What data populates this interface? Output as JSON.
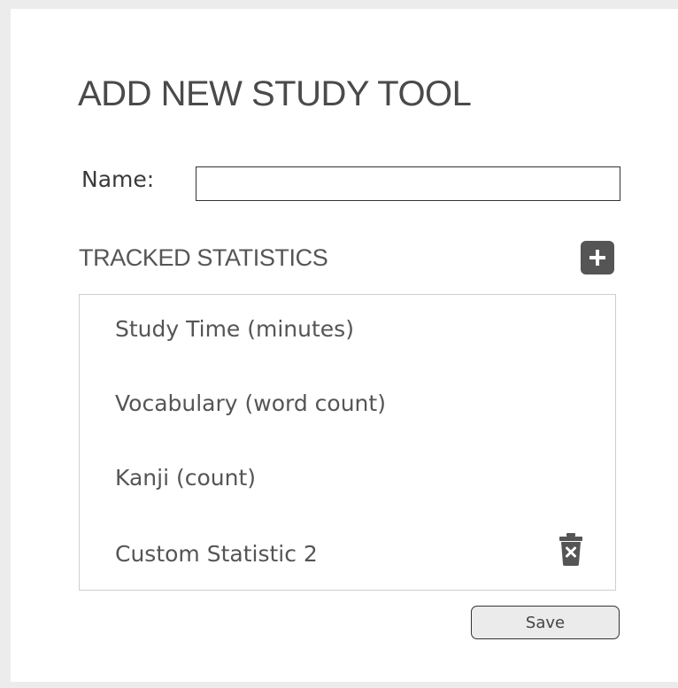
{
  "dialog": {
    "title": "ADD NEW STUDY TOOL",
    "name_label": "Name:",
    "name_value": "",
    "section_title": "TRACKED STATISTICS",
    "add_icon": "plus-icon",
    "delete_icon": "trash-icon",
    "statistics": [
      {
        "label": "Study Time (minutes)"
      },
      {
        "label": "Vocabulary (word count)"
      },
      {
        "label": "Kanji (count)"
      },
      {
        "label": "Custom Statistic 2"
      }
    ],
    "save_label": "Save"
  },
  "colors": {
    "background": "#ececec",
    "panel": "#ffffff",
    "text": "#4a4a4a",
    "icon": "#555555",
    "button_bg": "#ebebeb"
  }
}
